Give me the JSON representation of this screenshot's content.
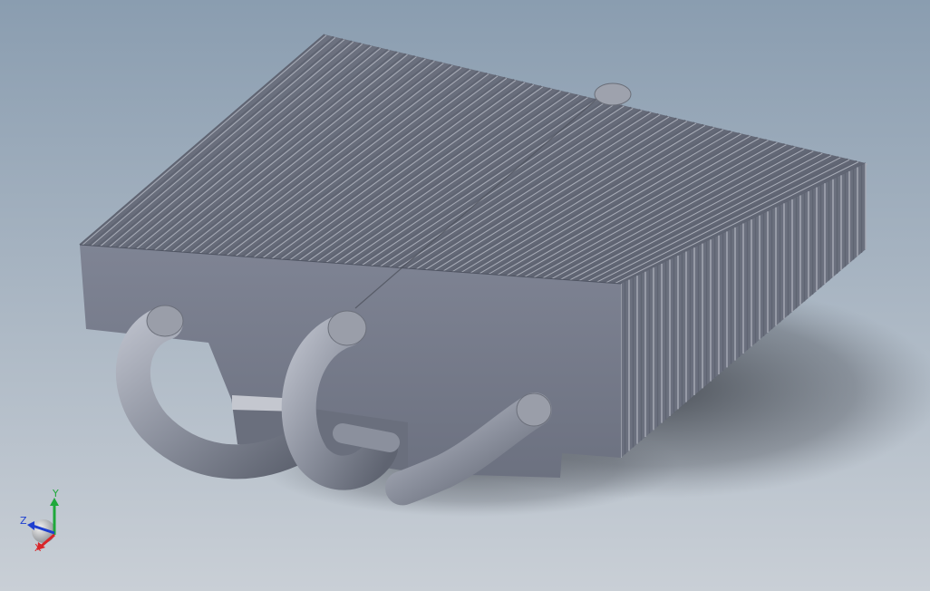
{
  "viewport": {
    "background_top": "#8a9db0",
    "background_bottom": "#c9cfd6"
  },
  "model": {
    "body_color": "#7c8190",
    "fin_dark": "#5f6472",
    "fin_light": "#a9adb8",
    "pipe_color": "#8b909d"
  },
  "triad": {
    "x_label": "X",
    "y_label": "Y",
    "z_label": "Z",
    "x_color": "#d9262a",
    "y_color": "#1fa83a",
    "z_color": "#1e3fd0"
  }
}
